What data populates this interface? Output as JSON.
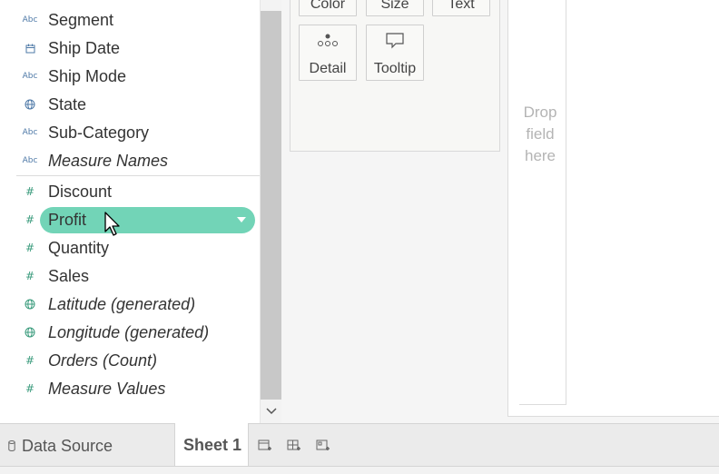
{
  "data_pane": {
    "dimensions": [
      {
        "label": "Segment",
        "icon": "abc-icon",
        "italic": false
      },
      {
        "label": "Ship Date",
        "icon": "calendar-icon",
        "italic": false
      },
      {
        "label": "Ship Mode",
        "icon": "abc-icon",
        "italic": false
      },
      {
        "label": "State",
        "icon": "globe-icon",
        "italic": false
      },
      {
        "label": "Sub-Category",
        "icon": "abc-icon",
        "italic": false
      },
      {
        "label": "Measure Names",
        "icon": "abc-icon",
        "italic": true
      }
    ],
    "measures": [
      {
        "label": "Discount",
        "icon": "hash-icon",
        "italic": false
      },
      {
        "label": "Profit",
        "icon": "hash-icon",
        "italic": false,
        "dragging": true
      },
      {
        "label": "Quantity",
        "icon": "hash-icon",
        "italic": false
      },
      {
        "label": "Sales",
        "icon": "hash-icon",
        "italic": false
      },
      {
        "label": "Latitude (generated)",
        "icon": "globe-icon",
        "italic": true
      },
      {
        "label": "Longitude (generated)",
        "icon": "globe-icon",
        "italic": true
      },
      {
        "label": "Orders (Count)",
        "icon": "hash-icon",
        "italic": true
      },
      {
        "label": "Measure Values",
        "icon": "hash-icon",
        "italic": true
      }
    ],
    "abc_glyph": "Abc",
    "hash_glyph": "#",
    "drag_pill_color": "#72d4b7"
  },
  "marks": {
    "buttons": [
      {
        "label": "Color",
        "icon": "color-icon"
      },
      {
        "label": "Size",
        "icon": "size-icon"
      },
      {
        "label": "Text",
        "icon": "text-icon"
      },
      {
        "label": "Detail",
        "icon": "detail-icon"
      },
      {
        "label": "Tooltip",
        "icon": "tooltip-icon"
      }
    ]
  },
  "canvas": {
    "drop_hint": "Drop\nfield\nhere"
  },
  "tabs": {
    "data_source": "Data Source",
    "sheet": "Sheet 1",
    "actions": [
      "new-worksheet-icon",
      "new-dashboard-icon",
      "new-story-icon"
    ]
  },
  "colors": {
    "dimension_icon": "#4e79a7",
    "measure_icon": "#3a9b7c"
  }
}
